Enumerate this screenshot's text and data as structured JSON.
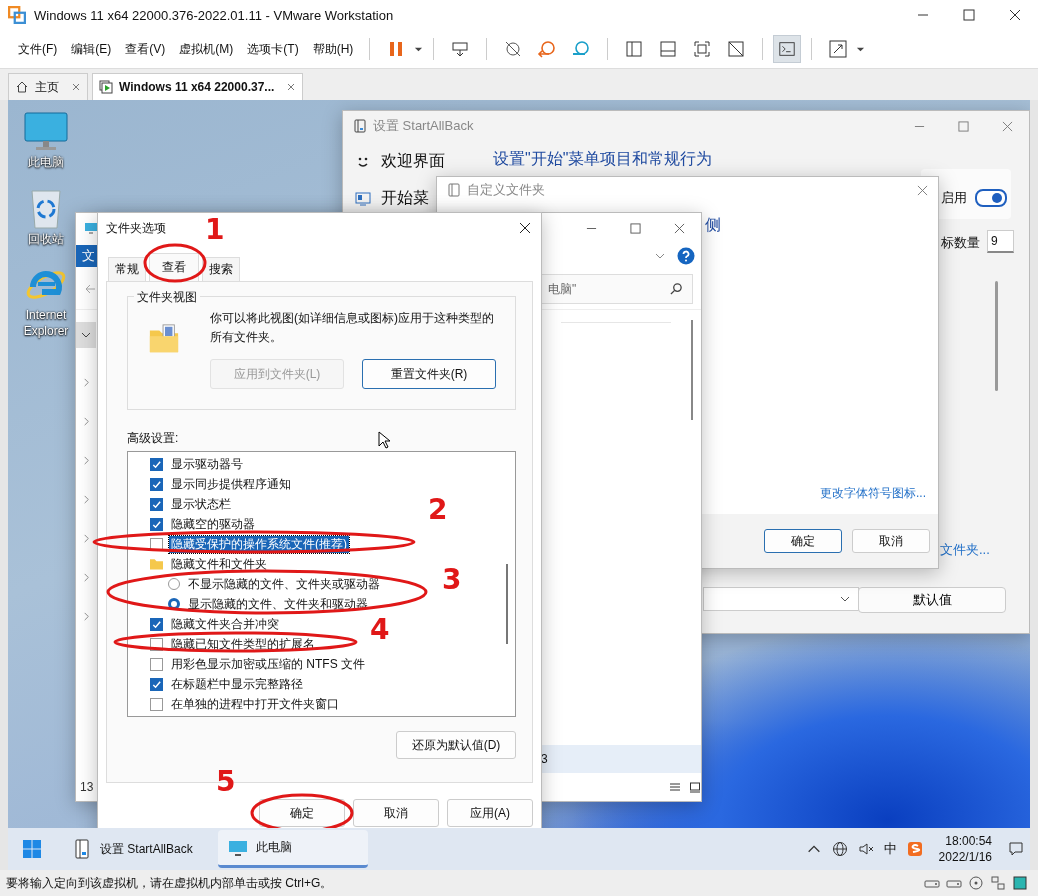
{
  "window": {
    "title": "Windows 11 x64 22000.376-2022.01.11 - VMware Workstation"
  },
  "menu": [
    "文件(F)",
    "编辑(E)",
    "查看(V)",
    "虚拟机(M)",
    "选项卡(T)",
    "帮助(H)"
  ],
  "tabs": [
    {
      "label": "主页",
      "selected": false,
      "kind": "home"
    },
    {
      "label": "Windows 11 x64 22000.37...",
      "selected": true,
      "kind": "vm"
    }
  ],
  "desktop_icons": [
    {
      "label": "此电脑",
      "kind": "pc"
    },
    {
      "label": "回收站",
      "kind": "bin"
    },
    {
      "label": "Internet Explorer",
      "kind": "ie"
    }
  ],
  "startallback": {
    "title": "设置 StartAllBack",
    "nav": [
      {
        "label": "欢迎界面",
        "kind": "smile"
      },
      {
        "label": "开始菜",
        "kind": "start"
      }
    ],
    "heading": "设置\"开始\"菜单项目和常规行为",
    "heading_fragment": "侧",
    "toggle": {
      "label": "启用",
      "on": true
    },
    "count": {
      "label": "标数量",
      "value": "9"
    },
    "link": "文件夹...",
    "button": "默认值"
  },
  "customize": {
    "title": "自定义文件夹",
    "link": "更改字体符号图标...",
    "buttons": [
      "确定",
      "取消"
    ]
  },
  "explorer": {
    "ribbon_tab": "文",
    "search": {
      "placeholder": "电脑\""
    },
    "status_count": "13",
    "row_fragment": "3"
  },
  "folder_options": {
    "title": "文件夹选项",
    "tabs": [
      {
        "label": "常规",
        "selected": false
      },
      {
        "label": "查看",
        "selected": true
      },
      {
        "label": "搜索",
        "selected": false
      }
    ],
    "group_title": "文件夹视图",
    "description": "你可以将此视图(如详细信息或图标)应用于这种类型的所有文件夹。",
    "view_buttons": [
      {
        "label": "应用到文件夹(L)",
        "disabled": true
      },
      {
        "label": "重置文件夹(R)",
        "disabled": false
      }
    ],
    "advanced_label": "高级设置:",
    "settings": [
      {
        "kind": "checkbox",
        "label": "显示驱动器号",
        "checked": true,
        "selected": false
      },
      {
        "kind": "checkbox",
        "label": "显示同步提供程序通知",
        "checked": true,
        "selected": false
      },
      {
        "kind": "checkbox",
        "label": "显示状态栏",
        "checked": true,
        "selected": false
      },
      {
        "kind": "checkbox",
        "label": "隐藏空的驱动器",
        "checked": true,
        "selected": false
      },
      {
        "kind": "checkbox",
        "label": "隐藏受保护的操作系统文件(推荐)",
        "checked": false,
        "selected": true
      },
      {
        "kind": "folder",
        "label": "隐藏文件和文件夹",
        "selected": false
      },
      {
        "kind": "radio",
        "label": "不显示隐藏的文件、文件夹或驱动器",
        "checked": false,
        "selected": false
      },
      {
        "kind": "radio",
        "label": "显示隐藏的文件、文件夹和驱动器",
        "checked": true,
        "selected": false
      },
      {
        "kind": "checkbox",
        "label": "隐藏文件夹合并冲突",
        "checked": true,
        "selected": false
      },
      {
        "kind": "checkbox",
        "label": "隐藏已知文件类型的扩展名",
        "checked": false,
        "selected": false
      },
      {
        "kind": "checkbox",
        "label": "用彩色显示加密或压缩的 NTFS 文件",
        "checked": false,
        "selected": false
      },
      {
        "kind": "checkbox",
        "label": "在标题栏中显示完整路径",
        "checked": true,
        "selected": false
      },
      {
        "kind": "checkbox",
        "label": "在单独的进程中打开文件夹窗口",
        "checked": false,
        "selected": false
      }
    ],
    "restore_button": "还原为默认值(D)",
    "buttons": [
      "确定",
      "取消",
      "应用(A)"
    ]
  },
  "annotations": [
    "1",
    "2",
    "3",
    "4",
    "5"
  ],
  "taskbar": {
    "apps": [
      {
        "label": "设置 StartAllBack",
        "kind": "settings",
        "selected": false
      },
      {
        "label": "此电脑",
        "kind": "pc",
        "selected": true
      }
    ],
    "ime": "中",
    "time": "18:00:54",
    "date": "2022/1/16"
  },
  "status_bar": "要将输入定向到该虚拟机，请在虚拟机内部单击或按 Ctrl+G。"
}
